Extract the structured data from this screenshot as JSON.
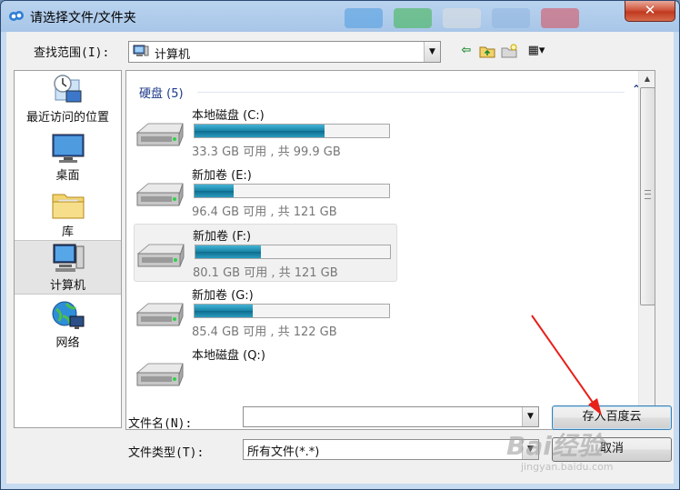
{
  "window": {
    "title": "请选择文件/文件夹",
    "close_label": "✕"
  },
  "toolbar": {
    "lookin_label": "查找范围(I):",
    "lookin_value": "计算机",
    "back_glyph": "⇦",
    "view_glyph": "▦▾"
  },
  "places": [
    {
      "label": "最近访问的位置",
      "icon": "recent-places-icon",
      "selected": false
    },
    {
      "label": "桌面",
      "icon": "desktop-icon",
      "selected": false
    },
    {
      "label": "库",
      "icon": "libraries-icon",
      "selected": false
    },
    {
      "label": "计算机",
      "icon": "computer-icon",
      "selected": true
    },
    {
      "label": "网络",
      "icon": "network-icon",
      "selected": false
    }
  ],
  "group": {
    "header": "硬盘 (5)"
  },
  "drives": [
    {
      "name": "本地磁盘 (C:)",
      "free_text": "33.3 GB 可用 , 共 99.9 GB",
      "used_fraction": 0.667,
      "selected": false
    },
    {
      "name": "新加卷 (E:)",
      "free_text": "96.4 GB 可用 , 共 121 GB",
      "used_fraction": 0.203,
      "selected": false
    },
    {
      "name": "新加卷 (F:)",
      "free_text": "80.1 GB 可用 , 共 121 GB",
      "used_fraction": 0.338,
      "selected": true
    },
    {
      "name": "新加卷 (G:)",
      "free_text": "85.4 GB 可用 , 共 122 GB",
      "used_fraction": 0.3,
      "selected": false
    },
    {
      "name": "本地磁盘 (Q:)",
      "free_text": "",
      "used_fraction": 0,
      "selected": false
    }
  ],
  "bottom": {
    "filename_label": "文件名(N):",
    "filename_value": "",
    "filetype_label": "文件类型(T):",
    "filetype_value": "所有文件(*.*)",
    "save_button": "存入百度云",
    "cancel_button": "取消"
  },
  "watermark": {
    "brand": "Bai经验",
    "url": "jingyan.baidu.com"
  },
  "colors": {
    "accent": "#1883a6",
    "annotation_arrow": "#e8201a",
    "close_red": "#c0391f"
  }
}
